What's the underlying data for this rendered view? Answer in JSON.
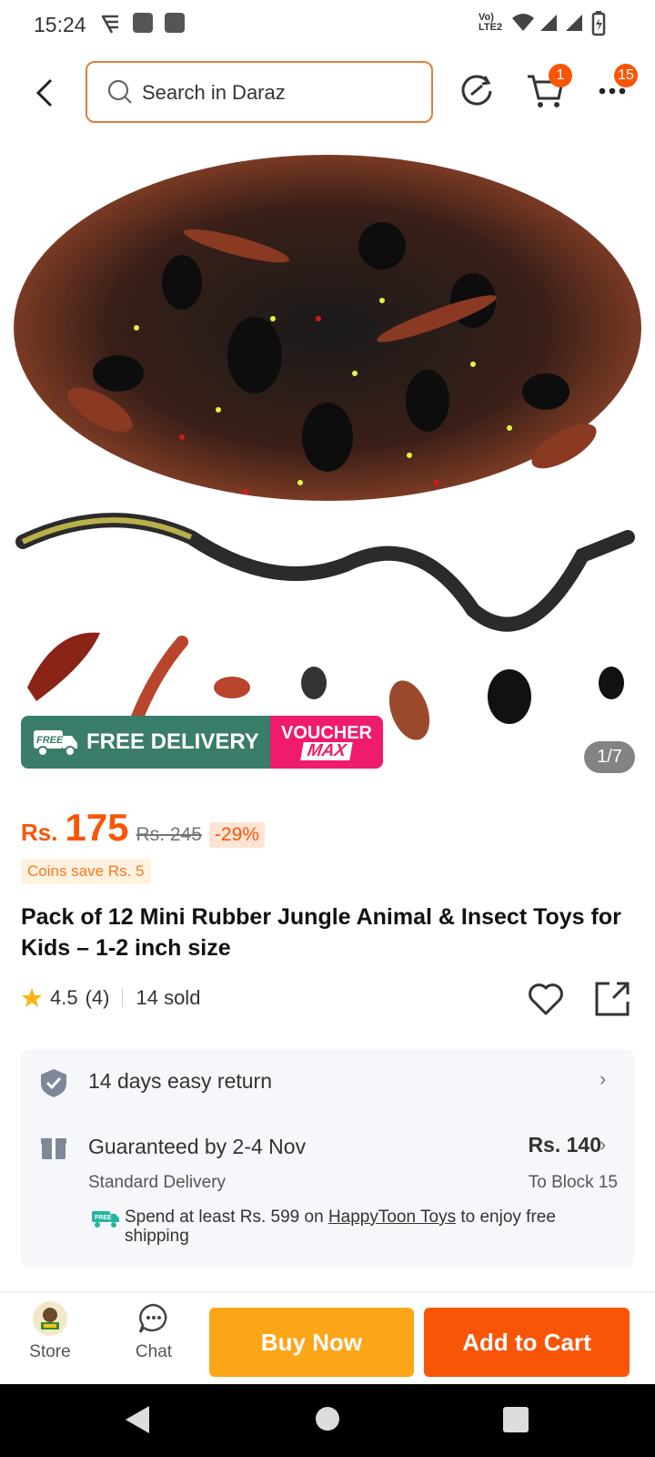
{
  "status_bar": {
    "time": "15:24",
    "network": "Vo) LTE2"
  },
  "header": {
    "search_placeholder": "Search in Daraz",
    "cart_badge": "1",
    "more_badge": "15"
  },
  "gallery": {
    "promo_free_delivery": "FREE DELIVERY",
    "promo_free_tag": "FREE",
    "promo_voucher": "VOUCHER",
    "promo_max": "MAX",
    "counter": "1/7"
  },
  "product": {
    "currency": "Rs.",
    "price": "175",
    "old_price": "Rs. 245",
    "discount": "-29%",
    "coins": "Coins save Rs. 5",
    "title": "Pack of 12 Mini Rubber Jungle Animal & Insect Toys for Kids – 1-2 inch size",
    "rating": "4.5",
    "rating_count": "(4)",
    "sold": "14 sold"
  },
  "services": {
    "return_label": "14 days easy return",
    "delivery_label": "Guaranteed by 2-4 Nov",
    "delivery_price": "Rs. 140",
    "delivery_type": "Standard Delivery",
    "delivery_location": "To Block 15",
    "free_ship_prefix": "Spend at least Rs. 599 on",
    "free_ship_store": "HappyToon Toys",
    "free_ship_suffix": "to enjoy free shipping",
    "free_badge": "FREE"
  },
  "bottom_bar": {
    "store_label": "Store",
    "chat_label": "Chat",
    "buy_now": "Buy Now",
    "add_to_cart": "Add to Cart"
  },
  "colors": {
    "accent": "#f85606",
    "buy_now": "#fda619",
    "add_to_cart": "#f85606",
    "free_delivery": "#3a7d6a",
    "voucher": "#ef1b6c"
  }
}
